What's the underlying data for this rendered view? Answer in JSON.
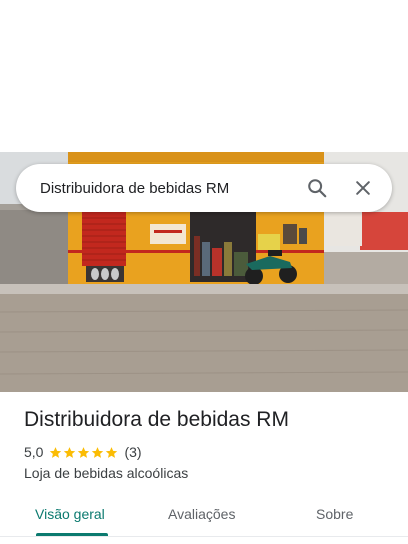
{
  "search": {
    "query": "Distribuidora de bebidas RM"
  },
  "place": {
    "name": "Distribuidora de bebidas RM",
    "rating": "5,0",
    "rating_value": 5,
    "review_count": "(3)",
    "category": "Loja de bebidas alcoólicas"
  },
  "tabs": [
    {
      "label": "Visão geral",
      "active": true
    },
    {
      "label": "Avaliações",
      "active": false
    },
    {
      "label": "Sobre",
      "active": false
    }
  ],
  "icons": {
    "search": "search-icon",
    "close": "close-icon",
    "star": "star-icon"
  },
  "colors": {
    "accent": "#0b7a6f",
    "star": "#fbbc04",
    "storefront": "#e9a21f",
    "shutter": "#c2281e"
  }
}
